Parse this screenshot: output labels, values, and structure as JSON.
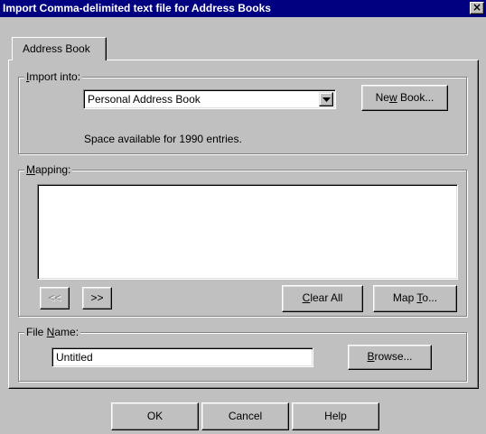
{
  "window": {
    "title": "Import Comma-delimited text file for Address Books",
    "close_glyph": "×"
  },
  "tab": {
    "label": "Address Book"
  },
  "import_into": {
    "legend_pre": "",
    "legend_key": "I",
    "legend_post": "mport into:",
    "selected_book": "Personal Address Book",
    "new_book_pre": "Ne",
    "new_book_key": "w",
    "new_book_post": " Book...",
    "space_available": "Space available for 1990 entries."
  },
  "mapping": {
    "legend_pre": "",
    "legend_key": "M",
    "legend_post": "apping:",
    "prev_label": "<<",
    "next_label": ">>",
    "clear_all_pre": "",
    "clear_all_key": "C",
    "clear_all_post": "lear All",
    "map_to_pre": "Map ",
    "map_to_key": "T",
    "map_to_post": "o...",
    "items": []
  },
  "file_name": {
    "legend_pre": "File ",
    "legend_key": "N",
    "legend_post": "ame:",
    "value": "Untitled",
    "browse_pre": "",
    "browse_key": "B",
    "browse_post": "rowse..."
  },
  "footer": {
    "ok_label": "OK",
    "cancel_label": "Cancel",
    "help_label": "Help"
  }
}
